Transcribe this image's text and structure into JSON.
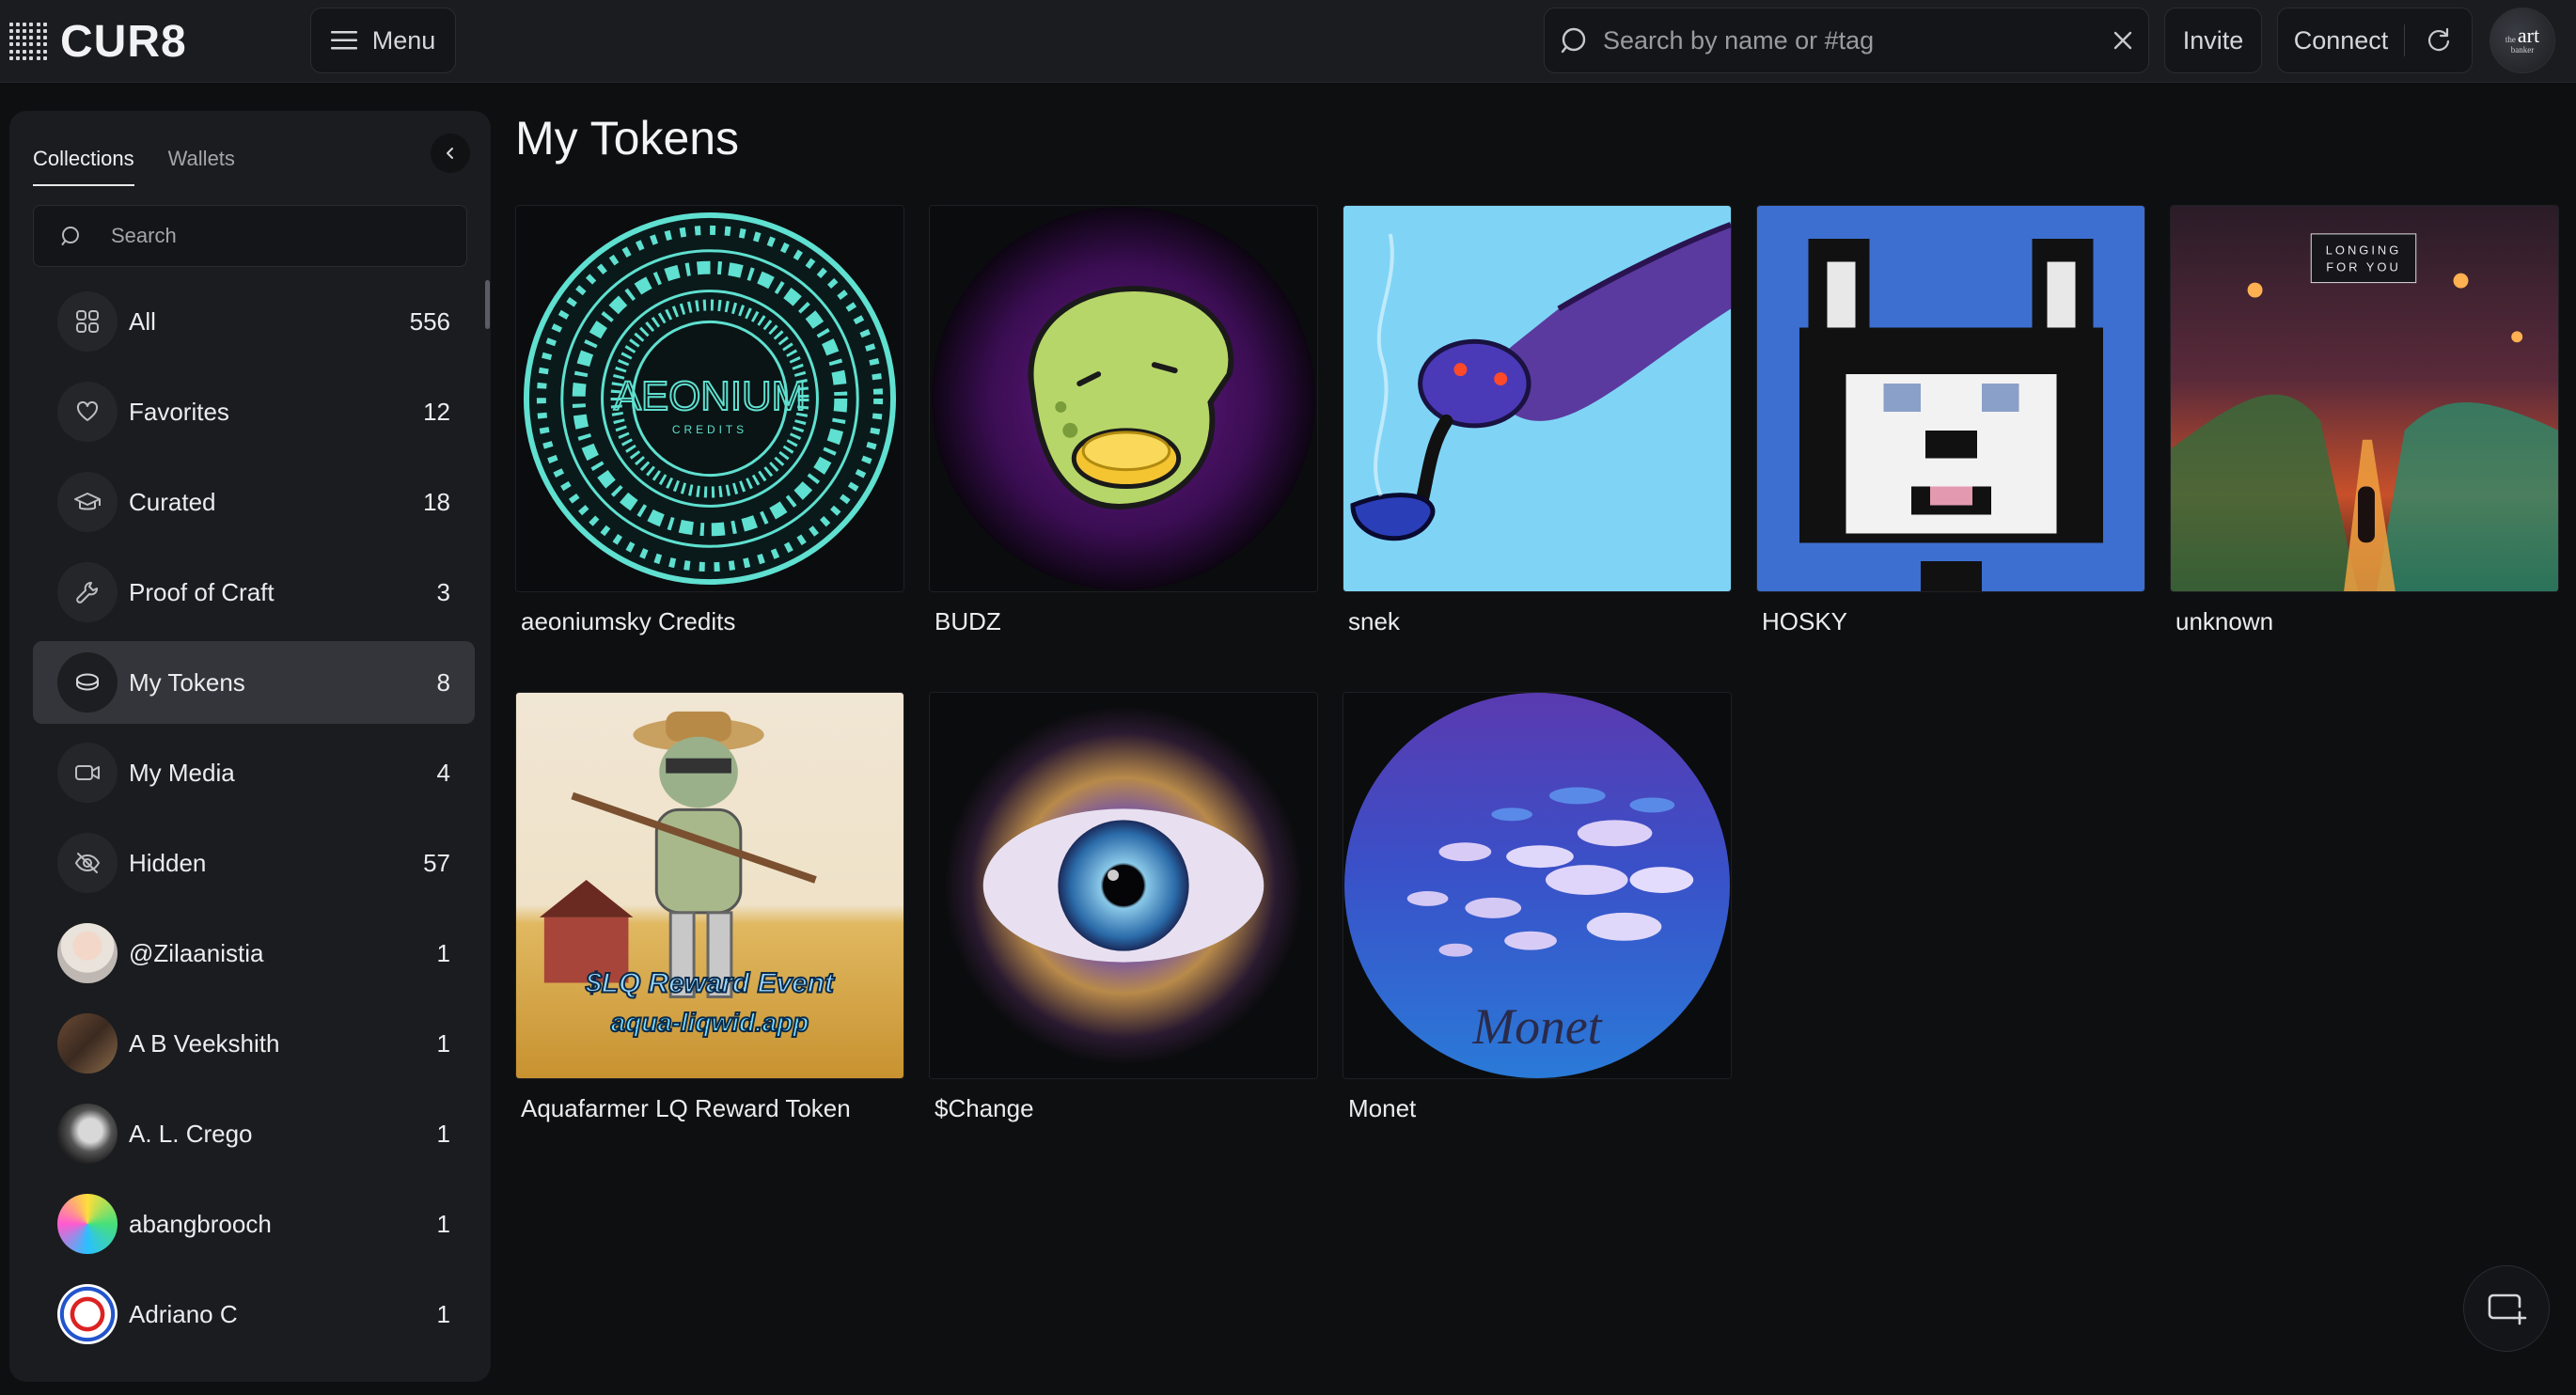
{
  "app": {
    "logo_text": "CUR8"
  },
  "topbar": {
    "menu_label": "Menu",
    "search_placeholder": "Search by name or #tag",
    "invite_label": "Invite",
    "connect_label": "Connect",
    "avatar_text_main": "art",
    "avatar_text_pre": "the",
    "avatar_text_sub": "banker"
  },
  "sidebar": {
    "tabs": [
      {
        "label": "Collections",
        "active": true
      },
      {
        "label": "Wallets",
        "active": false
      }
    ],
    "search_placeholder": "Search",
    "items": [
      {
        "label": "All",
        "count": "556",
        "icon": "grid-icon"
      },
      {
        "label": "Favorites",
        "count": "12",
        "icon": "heart-icon"
      },
      {
        "label": "Curated",
        "count": "18",
        "icon": "graduation-cap-icon"
      },
      {
        "label": "Proof of Craft",
        "count": "3",
        "icon": "wrench-icon"
      },
      {
        "label": "My Tokens",
        "count": "8",
        "icon": "coins-icon",
        "active": true
      },
      {
        "label": "My Media",
        "count": "4",
        "icon": "video-icon"
      },
      {
        "label": "Hidden",
        "count": "57",
        "icon": "eye-off-icon"
      },
      {
        "label": "@Zilaanistia",
        "count": "1",
        "icon": "avatar"
      },
      {
        "label": "A B Veekshith",
        "count": "1",
        "icon": "avatar"
      },
      {
        "label": "A. L. Crego",
        "count": "1",
        "icon": "avatar"
      },
      {
        "label": "abangbrooch",
        "count": "1",
        "icon": "avatar"
      },
      {
        "label": "Adriano C",
        "count": "1",
        "icon": "avatar"
      }
    ]
  },
  "main": {
    "title": "My Tokens",
    "tokens": [
      {
        "name": "aeoniumsky Credits",
        "image_text": "AEONIUM",
        "image_subtext": "CREDITS"
      },
      {
        "name": "BUDZ"
      },
      {
        "name": "snek"
      },
      {
        "name": "HOSKY"
      },
      {
        "name": "unknown",
        "image_text": "LONGING",
        "image_subtext": "FOR YOU"
      },
      {
        "name": "Aquafarmer LQ Reward Token",
        "image_text": "$LQ Reward Event",
        "image_subtext": "aqua-liqwid.app"
      },
      {
        "name": "$Change"
      },
      {
        "name": "Monet",
        "image_text": "Monet"
      }
    ]
  },
  "colors": {
    "background": "#0e0f11",
    "panel": "#1b1c1f",
    "active_item": "#33353b",
    "text": "#ececee"
  }
}
